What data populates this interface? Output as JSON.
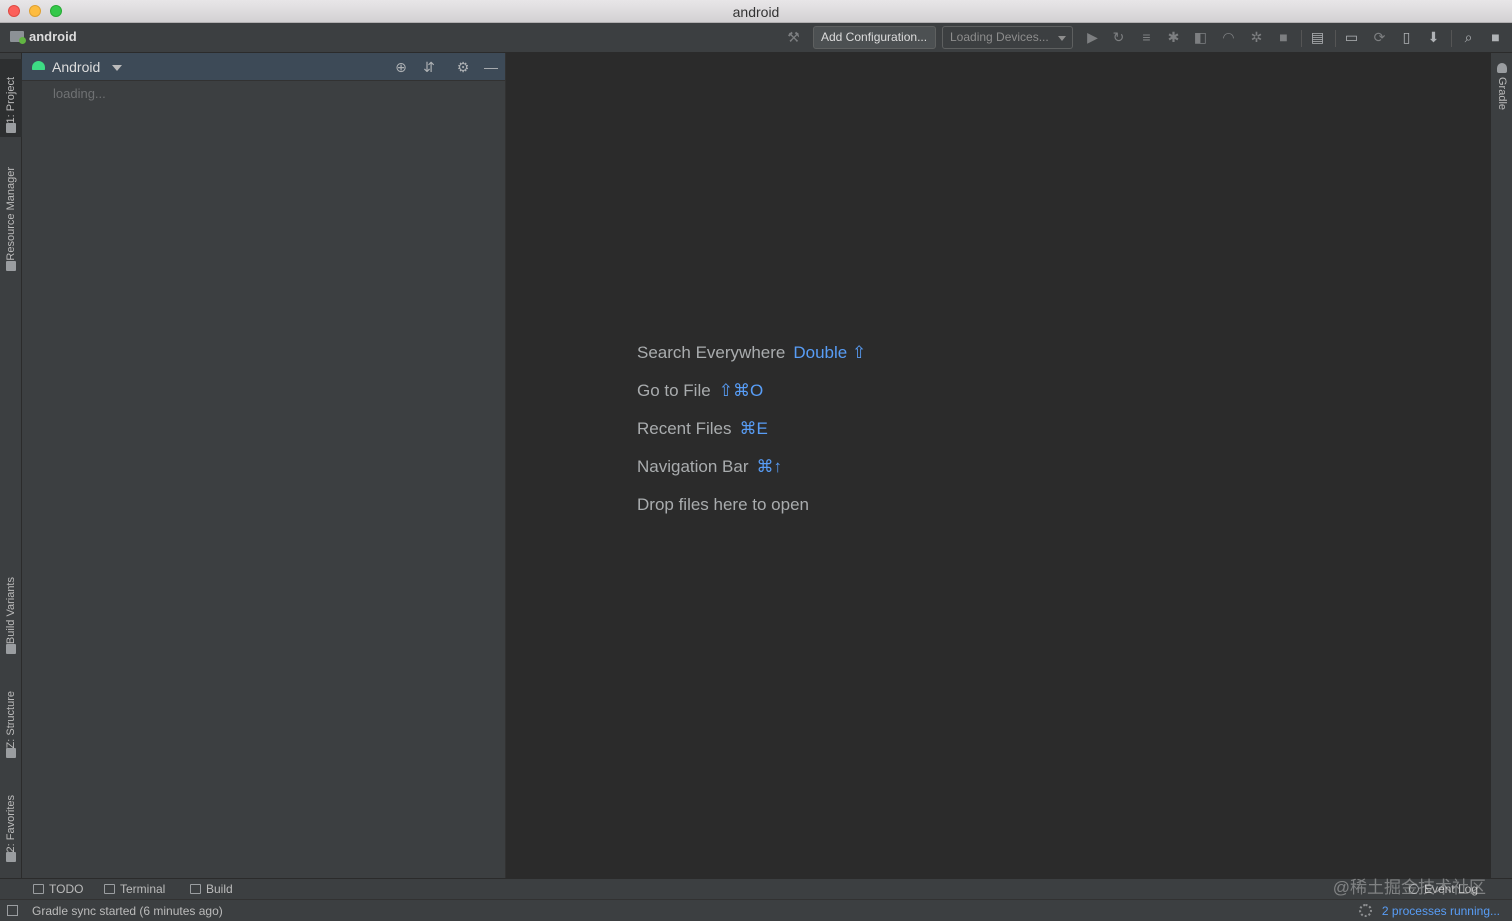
{
  "window": {
    "title": "android"
  },
  "navbar": {
    "project_name": "android",
    "add_configuration": "Add Configuration...",
    "device_selector": "Loading Devices..."
  },
  "left_tabs": {
    "project": "1: Project",
    "resource_manager": "Resource Manager",
    "build_variants": "Build Variants",
    "structure": "Z: Structure",
    "favorites": "2: Favorites"
  },
  "right_tabs": {
    "gradle": "Gradle"
  },
  "project_panel": {
    "view_mode": "Android",
    "loading_text": "loading..."
  },
  "editor": {
    "hints": [
      {
        "label": "Search Everywhere",
        "shortcut": "Double ⇧"
      },
      {
        "label": "Go to File",
        "shortcut": "⇧⌘O"
      },
      {
        "label": "Recent Files",
        "shortcut": "⌘E"
      },
      {
        "label": "Navigation Bar",
        "shortcut": "⌘↑"
      },
      {
        "label": "Drop files here to open",
        "shortcut": ""
      }
    ]
  },
  "bottom_tabs": {
    "todo": "TODO",
    "terminal": "Terminal",
    "build": "Build",
    "event_log": "Event Log"
  },
  "watermark": "@稀土掘金技术社区",
  "status": {
    "message": "Gradle sync started (6 minutes ago)",
    "processes": "2 processes running..."
  },
  "icons": {
    "run": "run-icon",
    "debug": "debug-icon",
    "search": "search-icon"
  },
  "colors": {
    "accent": "#589df6",
    "android_green": "#3ddc84",
    "panel_header": "#3d4a57"
  }
}
